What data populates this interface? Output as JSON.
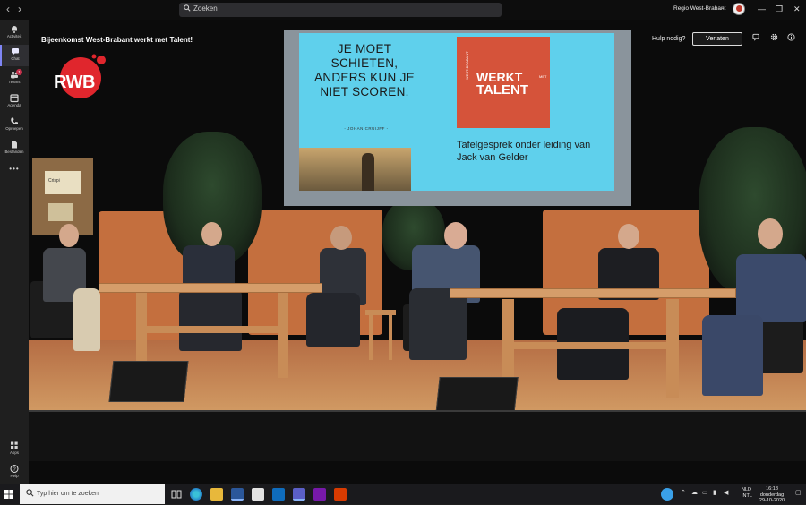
{
  "titlebar": {
    "back_arrow": "‹",
    "forward_arrow": "›",
    "search_placeholder": "Zoeken",
    "org_name": "Regio West-Brabant",
    "org_chevron": "⌄",
    "minimize": "—",
    "maximize": "❐",
    "close": "✕"
  },
  "rail": {
    "items": [
      {
        "label": "Activiteit",
        "icon": "bell-icon"
      },
      {
        "label": "Chat",
        "icon": "chat-icon"
      },
      {
        "label": "Teams",
        "icon": "teams-icon",
        "badge": "1"
      },
      {
        "label": "Agenda",
        "icon": "calendar-icon"
      },
      {
        "label": "Oproepen",
        "icon": "phone-icon"
      },
      {
        "label": "Bestanden",
        "icon": "file-icon"
      },
      {
        "label": "",
        "icon": "more-icon",
        "glyph": "•••"
      }
    ],
    "bottom": [
      {
        "label": "Apps",
        "icon": "apps-icon"
      },
      {
        "label": "Help",
        "icon": "help-icon"
      }
    ]
  },
  "meeting": {
    "title": "Bijeenkomst West-Brabant werkt met Talent!",
    "help_label": "Hulp nodig?",
    "leave_label": "Verlaten"
  },
  "video": {
    "logo_text": "RWB",
    "slide_quote": "JE MOET SCHIETEN, ANDERS KUN JE NIET SCOREN.",
    "slide_author": "- JOHAN CRUIJFF -",
    "brand_small": "WEST-BRABANT",
    "brand_line1": "WERKT",
    "brand_side": "MET",
    "brand_line2": "TALENT",
    "slide_subtitle": "Tafelgesprek onder leiding van Jack van Gelder",
    "poster_text": "Crispi"
  },
  "taskbar": {
    "search_placeholder": "Typ hier om te zoeken",
    "lang_line1": "NLD",
    "lang_line2": "INTL",
    "time": "16:18",
    "day": "donderdag",
    "date": "29-10-2020"
  },
  "colors": {
    "accent": "#7f85f5",
    "leave_border": "#dddddd",
    "slide_bg": "#5fd0ec",
    "brand_red": "#d5533a",
    "logo_red": "#e0262d"
  }
}
